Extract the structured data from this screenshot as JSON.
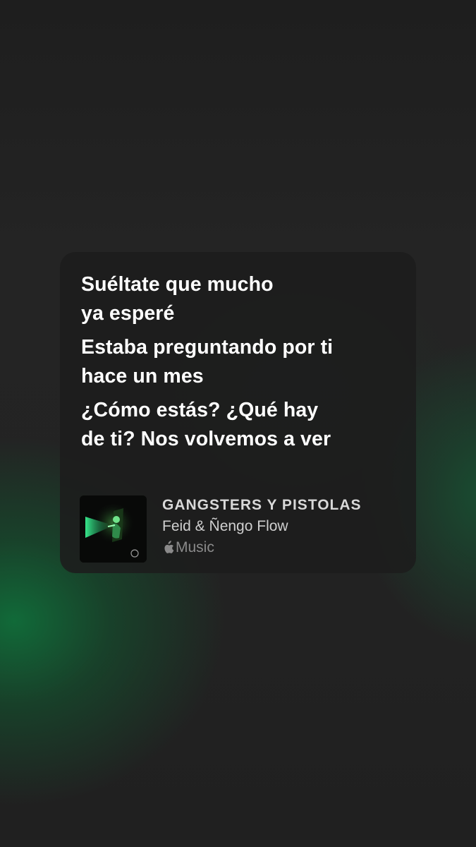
{
  "lyrics": [
    {
      "lines": [
        "Suéltate que mucho",
        "ya esperé"
      ]
    },
    {
      "lines": [
        "Estaba preguntando por ti",
        "hace un mes"
      ]
    },
    {
      "lines": [
        "¿Cómo estás? ¿Qué hay",
        "de ti? Nos volvemos a ver"
      ]
    }
  ],
  "track": {
    "title": "GANGSTERS Y PISTOLAS",
    "artist": "Feid & Ñengo Flow",
    "service_label": "Music",
    "service_icon": "apple-logo-icon",
    "artwork_icon": "album-artwork"
  },
  "colors": {
    "background": "#1f1f1f",
    "glow": "#106e3a",
    "card": "#1c1c1c",
    "lyric_text": "#ffffff",
    "secondary_text": "#8a8a8a"
  }
}
